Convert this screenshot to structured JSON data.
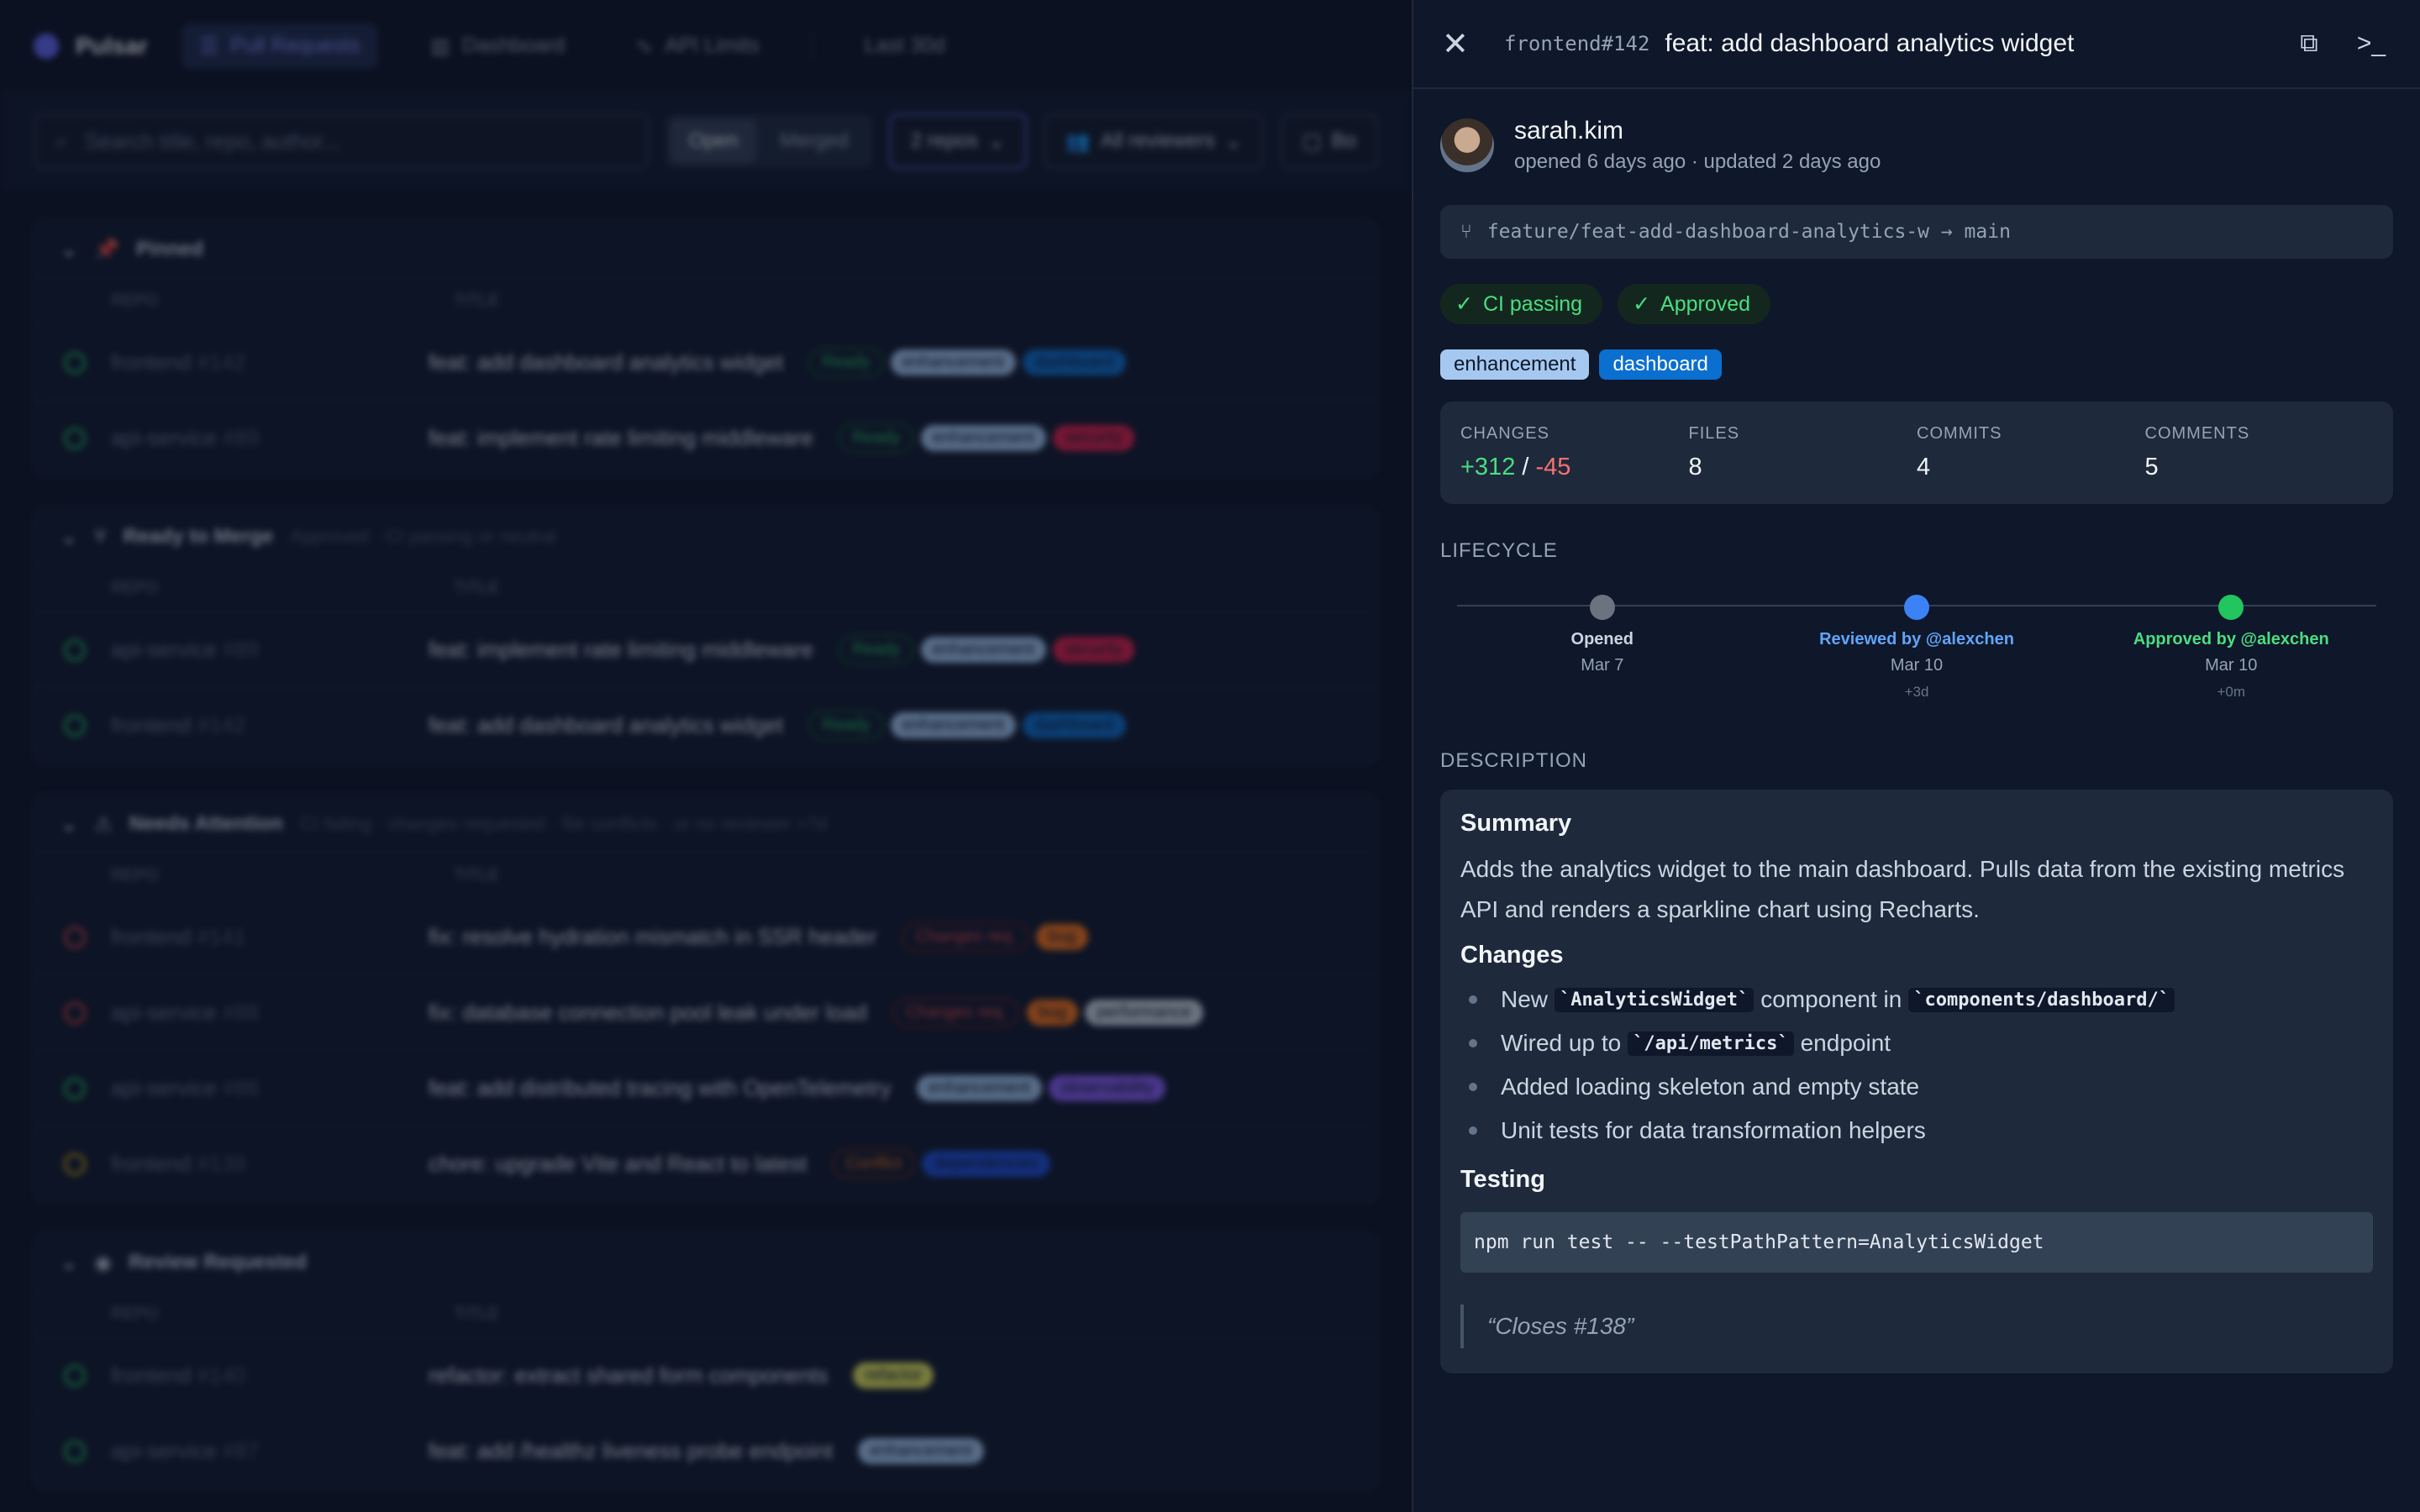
{
  "app": {
    "name": "Pulsar",
    "nav": [
      "Pull Requests",
      "Dashboard",
      "API Limits"
    ],
    "range": "Last 30d"
  },
  "toolbar": {
    "search_placeholder": "Search title, repo, author...",
    "state_tabs": [
      "Open",
      "Merged"
    ],
    "repos_filter": "2 repos",
    "reviewers_filter": "All reviewers",
    "bots_filter": "Bo"
  },
  "columns": {
    "repo": "REPO",
    "title": "TITLE"
  },
  "sections": [
    {
      "title": "Pinned",
      "subtitle": "",
      "rows": [
        {
          "repo": "frontend",
          "num": "#142",
          "title": "feat: add dashboard analytics widget",
          "status": "Ready",
          "labels": [
            "enhancement",
            "dashboard"
          ]
        },
        {
          "repo": "api-service",
          "num": "#89",
          "title": "feat: implement rate limiting middleware",
          "status": "Ready",
          "labels": [
            "enhancement",
            "security"
          ]
        }
      ]
    },
    {
      "title": "Ready to Merge",
      "subtitle": "Approved · CI passing or neutral",
      "rows": [
        {
          "repo": "api-service",
          "num": "#89",
          "title": "feat: implement rate limiting middleware",
          "status": "Ready",
          "labels": [
            "enhancement",
            "security"
          ]
        },
        {
          "repo": "frontend",
          "num": "#142",
          "title": "feat: add dashboard analytics widget",
          "status": "Ready",
          "labels": [
            "enhancement",
            "dashboard"
          ]
        }
      ]
    },
    {
      "title": "Needs Attention",
      "subtitle": "CI failing · changes requested · file conflicts · or no reviewer >7d",
      "rows": [
        {
          "repo": "frontend",
          "num": "#141",
          "title": "fix: resolve hydration mismatch in SSR header",
          "status": "Changes req.",
          "labels": [
            "bug"
          ]
        },
        {
          "repo": "api-service",
          "num": "#88",
          "title": "fix: database connection pool leak under load",
          "status": "Changes req.",
          "labels": [
            "bug",
            "performance"
          ]
        },
        {
          "repo": "api-service",
          "num": "#86",
          "title": "feat: add distributed tracing with OpenTelemetry",
          "status": "",
          "labels": [
            "enhancement",
            "observability"
          ]
        },
        {
          "repo": "frontend",
          "num": "#139",
          "title": "chore: upgrade Vite and React to latest",
          "status": "Conflict",
          "labels": [
            "dependencies"
          ]
        }
      ]
    },
    {
      "title": "Review Requested",
      "subtitle": "",
      "rows": [
        {
          "repo": "frontend",
          "num": "#140",
          "title": "refactor: extract shared form components",
          "status": "",
          "labels": [
            "refactor"
          ]
        },
        {
          "repo": "api-service",
          "num": "#87",
          "title": "feat: add /healthz liveness probe endpoint",
          "status": "",
          "labels": [
            "enhancement"
          ]
        }
      ]
    }
  ],
  "label_colors": {
    "enhancement": "#a5c8f0",
    "dashboard": "#0b6fd0",
    "security": "#e11d48",
    "bug": "#f97316",
    "performance": "#cbd5e1",
    "observability": "#8b5cf6",
    "dependencies": "#1d4ed8",
    "refactor": "#e6e65a"
  },
  "panel": {
    "ref": "frontend#142",
    "title": "feat: add dashboard analytics widget",
    "author": "sarah.kim",
    "meta": "opened 6 days ago · updated 2 days ago",
    "branch": "feature/feat-add-dashboard-analytics-w → main",
    "ci": "CI passing",
    "review": "Approved",
    "labels": [
      {
        "name": "enhancement",
        "bg": "#a5c8f0",
        "fg": "#0f172a"
      },
      {
        "name": "dashboard",
        "bg": "#0b6fd0",
        "fg": "#ffffff"
      }
    ],
    "stats": {
      "changes_label": "CHANGES",
      "additions": "+312",
      "sep": "/",
      "deletions": "-45",
      "files_label": "FILES",
      "files": "8",
      "commits_label": "COMMITS",
      "commits": "4",
      "comments_label": "COMMENTS",
      "comments": "5"
    },
    "lifecycle_label": "LIFECYCLE",
    "lifecycle": [
      {
        "label": "Opened",
        "date": "Mar 7",
        "delta": "",
        "color": "#6b7280",
        "text_color": "#cbd5e1"
      },
      {
        "label": "Reviewed by @alexchen",
        "date": "Mar 10",
        "delta": "+3d",
        "color": "#3b82f6",
        "text_color": "#60a5fa"
      },
      {
        "label": "Approved by @alexchen",
        "date": "Mar 10",
        "delta": "+0m",
        "color": "#22c55e",
        "text_color": "#4ade80"
      }
    ],
    "description_label": "DESCRIPTION",
    "description": {
      "summary_heading": "Summary",
      "summary_text": "Adds the analytics widget to the main dashboard. Pulls data from the existing metrics API and renders a sparkline chart using Recharts.",
      "changes_heading": "Changes",
      "changes": [
        {
          "pre": "New",
          "code": "`AnalyticsWidget`",
          "mid": "component in",
          "code2": "`components/dashboard/`",
          "post": ""
        },
        {
          "pre": "Wired up to",
          "code": "`/api/metrics`",
          "mid": "endpoint",
          "code2": "",
          "post": ""
        },
        {
          "pre": "Added loading skeleton and empty state",
          "code": "",
          "mid": "",
          "code2": "",
          "post": ""
        },
        {
          "pre": "Unit tests for data transformation helpers",
          "code": "",
          "mid": "",
          "code2": "",
          "post": ""
        }
      ],
      "testing_heading": "Testing",
      "testing_command": "npm run test -- --testPathPattern=AnalyticsWidget",
      "quote": "“Closes #138”"
    }
  }
}
